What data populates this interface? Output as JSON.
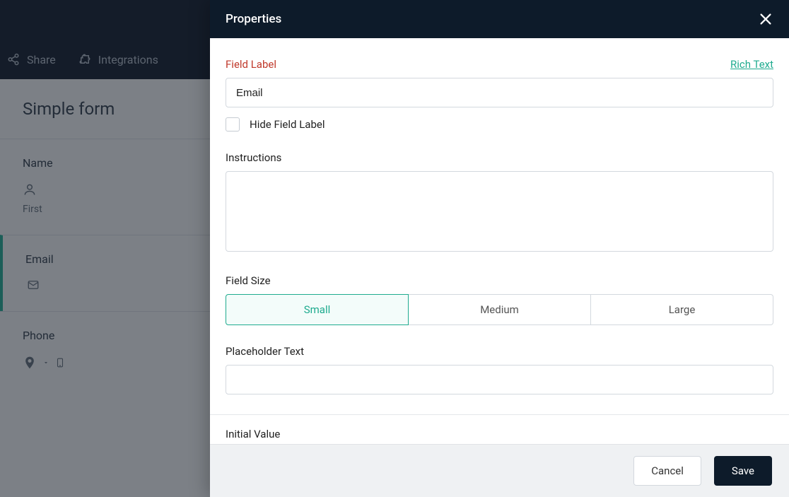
{
  "background": {
    "toolbar": {
      "share": "Share",
      "integrations": "Integrations"
    },
    "form_title": "Simple form",
    "fields": {
      "name": {
        "label": "Name",
        "sub": "First"
      },
      "email": {
        "label": "Email"
      },
      "phone": {
        "label": "Phone"
      }
    }
  },
  "panel": {
    "title": "Properties",
    "field_label_caption": "Field Label",
    "rich_text": "Rich Text",
    "field_label_value": "Email",
    "hide_label": "Hide Field Label",
    "instructions_caption": "Instructions",
    "instructions_value": "",
    "field_size_caption": "Field Size",
    "sizes": {
      "small": "Small",
      "medium": "Medium",
      "large": "Large"
    },
    "size_selected": "small",
    "placeholder_caption": "Placeholder Text",
    "placeholder_value": "",
    "initial_value_caption": "Initial Value",
    "footer": {
      "cancel": "Cancel",
      "save": "Save"
    }
  }
}
